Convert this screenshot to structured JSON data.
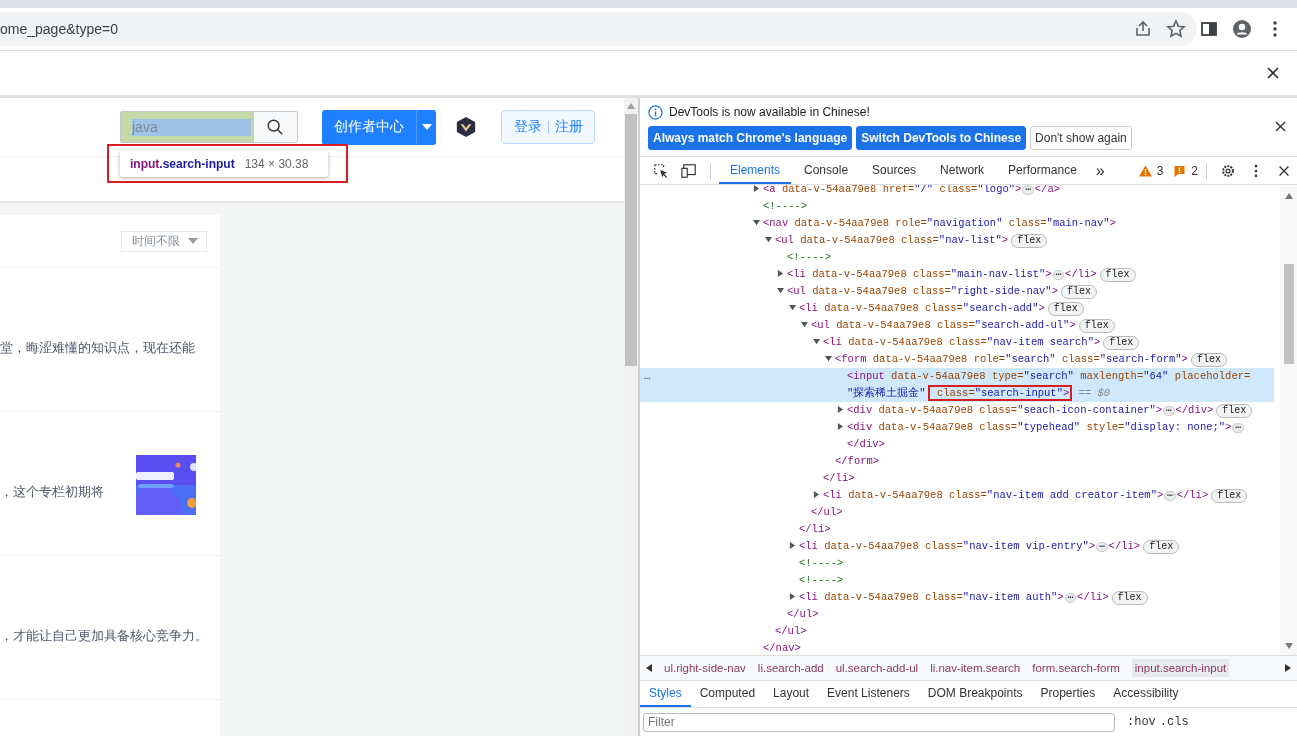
{
  "browser": {
    "url": "ome_page&type=0"
  },
  "page": {
    "search": {
      "value": "java",
      "selected": true
    },
    "creator_button": "创作者中心",
    "login": "登录",
    "register": "注册",
    "inspect_tooltip": {
      "tag": "input",
      "class": ".search-input",
      "size": "134 × 30.38",
      "boxed": true
    },
    "filter": "时间不限",
    "articles": [
      {
        "snippet": "堂，晦涩难懂的知识点，现在还能",
        "thumbnail": false
      },
      {
        "snippet": "，这个专栏初期将",
        "thumbnail": true
      },
      {
        "snippet": "，才能让自己更加具备核心竞争力。",
        "thumbnail": false
      }
    ]
  },
  "devtools": {
    "infobar": {
      "message": "DevTools is now available in Chinese!",
      "buttons": [
        {
          "label": "Always match Chrome's language",
          "kind": "primary"
        },
        {
          "label": "Switch DevTools to Chinese",
          "kind": "primary"
        },
        {
          "label": "Don't show again",
          "kind": "secondary"
        }
      ]
    },
    "tabs": [
      {
        "label": "Elements",
        "selected": true
      },
      {
        "label": "Console",
        "selected": false
      },
      {
        "label": "Sources",
        "selected": false
      },
      {
        "label": "Network",
        "selected": false
      },
      {
        "label": "Performance",
        "selected": false
      }
    ],
    "overflow": "»",
    "warnings": "3",
    "issues": "2",
    "tree": [
      {
        "selected": false,
        "expanded": false,
        "parts": [
          {
            "kind": "tag",
            "text": "<a"
          },
          {
            "kind": "attr",
            "text": " data-v-54aa79e8"
          },
          {
            "kind": "attr",
            "text": " href="
          },
          {
            "kind": "value",
            "text": "\"/\""
          },
          {
            "kind": "attr",
            "text": " class="
          },
          {
            "kind": "value",
            "text": "\"logo\""
          },
          {
            "kind": "tag",
            "text": ">"
          },
          {
            "kind": "more",
            "text": "⋯"
          },
          {
            "kind": "tag",
            "text": "</a>"
          }
        ]
      },
      {
        "selected": false,
        "parts": [
          {
            "kind": "comment",
            "text": "<!---->"
          }
        ]
      },
      {
        "selected": false,
        "expanded": true,
        "parts": [
          {
            "kind": "tag",
            "text": "<nav"
          },
          {
            "kind": "attr",
            "text": " data-v-54aa79e8"
          },
          {
            "kind": "attr",
            "text": " role="
          },
          {
            "kind": "value",
            "text": "\"navigation\""
          },
          {
            "kind": "attr",
            "text": " class="
          },
          {
            "kind": "value",
            "text": "\"main-nav\""
          },
          {
            "kind": "tag",
            "text": ">"
          }
        ],
        "close": "</nav>",
        "children": [
          {
            "selected": false,
            "expanded": true,
            "parts": [
              {
                "kind": "tag",
                "text": "<ul"
              },
              {
                "kind": "attr",
                "text": " data-v-54aa79e8"
              },
              {
                "kind": "attr",
                "text": " class="
              },
              {
                "kind": "value",
                "text": "\"nav-list\""
              },
              {
                "kind": "tag",
                "text": ">"
              },
              {
                "kind": "badge",
                "text": "flex"
              }
            ],
            "close": "</ul>",
            "children": [
              {
                "selected": false,
                "parts": [
                  {
                    "kind": "comment",
                    "text": "<!---->"
                  }
                ]
              },
              {
                "selected": false,
                "expanded": false,
                "parts": [
                  {
                    "kind": "tag",
                    "text": "<li"
                  },
                  {
                    "kind": "attr",
                    "text": " data-v-54aa79e8"
                  },
                  {
                    "kind": "attr",
                    "text": " class="
                  },
                  {
                    "kind": "value",
                    "text": "\"main-nav-list\""
                  },
                  {
                    "kind": "tag",
                    "text": ">"
                  },
                  {
                    "kind": "more",
                    "text": "⋯"
                  },
                  {
                    "kind": "tag",
                    "text": "</li>"
                  },
                  {
                    "kind": "badge",
                    "text": "flex"
                  }
                ]
              },
              {
                "selected": false,
                "expanded": true,
                "parts": [
                  {
                    "kind": "tag",
                    "text": "<ul"
                  },
                  {
                    "kind": "attr",
                    "text": " data-v-54aa79e8"
                  },
                  {
                    "kind": "attr",
                    "text": " class="
                  },
                  {
                    "kind": "value",
                    "text": "\"right-side-nav\""
                  },
                  {
                    "kind": "tag",
                    "text": ">"
                  },
                  {
                    "kind": "badge",
                    "text": "flex"
                  }
                ],
                "close": "</ul>",
                "children": [
                  {
                    "selected": false,
                    "expanded": true,
                    "parts": [
                      {
                        "kind": "tag",
                        "text": "<li"
                      },
                      {
                        "kind": "attr",
                        "text": " data-v-54aa79e8"
                      },
                      {
                        "kind": "attr",
                        "text": " class="
                      },
                      {
                        "kind": "value",
                        "text": "\"search-add\""
                      },
                      {
                        "kind": "tag",
                        "text": ">"
                      },
                      {
                        "kind": "badge",
                        "text": "flex"
                      }
                    ],
                    "close": "</li>",
                    "children": [
                      {
                        "selected": false,
                        "expanded": true,
                        "parts": [
                          {
                            "kind": "tag",
                            "text": "<ul"
                          },
                          {
                            "kind": "attr",
                            "text": " data-v-54aa79e8"
                          },
                          {
                            "kind": "attr",
                            "text": " class="
                          },
                          {
                            "kind": "value",
                            "text": "\"search-add-ul\""
                          },
                          {
                            "kind": "tag",
                            "text": ">"
                          },
                          {
                            "kind": "badge",
                            "text": "flex"
                          }
                        ],
                        "close": "</ul>",
                        "children": [
                          {
                            "selected": false,
                            "expanded": true,
                            "parts": [
                              {
                                "kind": "tag",
                                "text": "<li"
                              },
                              {
                                "kind": "attr",
                                "text": " data-v-54aa79e8"
                              },
                              {
                                "kind": "attr",
                                "text": " class="
                              },
                              {
                                "kind": "value",
                                "text": "\"nav-item search\""
                              },
                              {
                                "kind": "tag",
                                "text": ">"
                              },
                              {
                                "kind": "badge",
                                "text": "flex"
                              }
                            ],
                            "close": "</li>",
                            "children": [
                              {
                                "selected": false,
                                "expanded": true,
                                "parts": [
                                  {
                                    "kind": "tag",
                                    "text": "<form"
                                  },
                                  {
                                    "kind": "attr",
                                    "text": " data-v-54aa79e8"
                                  },
                                  {
                                    "kind": "attr",
                                    "text": " role="
                                  },
                                  {
                                    "kind": "value",
                                    "text": "\"search\""
                                  },
                                  {
                                    "kind": "attr",
                                    "text": " class="
                                  },
                                  {
                                    "kind": "value",
                                    "text": "\"search-form\""
                                  },
                                  {
                                    "kind": "tag",
                                    "text": ">"
                                  },
                                  {
                                    "kind": "badge",
                                    "text": "flex"
                                  }
                                ],
                                "close": "</form>",
                                "children": [
                                  {
                                    "selected": true,
                                    "gutter": "…",
                                    "parts": [
                                      {
                                        "kind": "tag",
                                        "text": "<input"
                                      },
                                      {
                                        "kind": "attr",
                                        "text": " data-v-54aa79e8"
                                      },
                                      {
                                        "kind": "attr",
                                        "text": " type="
                                      },
                                      {
                                        "kind": "value",
                                        "text": "\"search\""
                                      },
                                      {
                                        "kind": "attr",
                                        "text": " maxlength="
                                      },
                                      {
                                        "kind": "value",
                                        "text": "\"64\""
                                      },
                                      {
                                        "kind": "attr",
                                        "text": " placeholder="
                                      },
                                      {
                                        "kind": "value",
                                        "text": "\"探索稀土掘金\""
                                      },
                                      {
                                        "kind": "attr",
                                        "text": " class=",
                                        "boxed": true
                                      },
                                      {
                                        "kind": "value",
                                        "text": "\"search-input\"",
                                        "boxed": true
                                      },
                                      {
                                        "kind": "tag",
                                        "text": ">",
                                        "boxed": true
                                      },
                                      {
                                        "kind": "marker",
                                        "text": " == $0"
                                      }
                                    ]
                                  },
                                  {
                                    "selected": false,
                                    "expanded": false,
                                    "parts": [
                                      {
                                        "kind": "tag",
                                        "text": "<div"
                                      },
                                      {
                                        "kind": "attr",
                                        "text": " data-v-54aa79e8"
                                      },
                                      {
                                        "kind": "attr",
                                        "text": " class="
                                      },
                                      {
                                        "kind": "value",
                                        "text": "\"seach-icon-container\""
                                      },
                                      {
                                        "kind": "tag",
                                        "text": ">"
                                      },
                                      {
                                        "kind": "more",
                                        "text": "⋯"
                                      },
                                      {
                                        "kind": "tag",
                                        "text": "</div>"
                                      },
                                      {
                                        "kind": "badge",
                                        "text": "flex"
                                      }
                                    ]
                                  },
                                  {
                                    "selected": false,
                                    "expanded": false,
                                    "parts": [
                                      {
                                        "kind": "tag",
                                        "text": "<div"
                                      },
                                      {
                                        "kind": "attr",
                                        "text": " data-v-54aa79e8"
                                      },
                                      {
                                        "kind": "attr",
                                        "text": " class="
                                      },
                                      {
                                        "kind": "value",
                                        "text": "\"typehead\""
                                      },
                                      {
                                        "kind": "attr",
                                        "text": " style="
                                      },
                                      {
                                        "kind": "value",
                                        "text": "\"display: none;\""
                                      },
                                      {
                                        "kind": "tag",
                                        "text": ">"
                                      },
                                      {
                                        "kind": "more",
                                        "text": "⋯"
                                      },
                                      {
                                        "kind": "tag",
                                        "text": "</div>"
                                      }
                                    ]
                                  }
                                ]
                              }
                            ]
                          },
                          {
                            "selected": false,
                            "expanded": false,
                            "parts": [
                              {
                                "kind": "tag",
                                "text": "<li"
                              },
                              {
                                "kind": "attr",
                                "text": " data-v-54aa79e8"
                              },
                              {
                                "kind": "attr",
                                "text": " class="
                              },
                              {
                                "kind": "value",
                                "text": "\"nav-item add creator-item\""
                              },
                              {
                                "kind": "tag",
                                "text": ">"
                              },
                              {
                                "kind": "more",
                                "text": "⋯"
                              },
                              {
                                "kind": "tag",
                                "text": "</li>"
                              },
                              {
                                "kind": "badge",
                                "text": "flex"
                              }
                            ]
                          }
                        ]
                      }
                    ]
                  },
                  {
                    "selected": false,
                    "expanded": false,
                    "parts": [
                      {
                        "kind": "tag",
                        "text": "<li"
                      },
                      {
                        "kind": "attr",
                        "text": " data-v-54aa79e8"
                      },
                      {
                        "kind": "attr",
                        "text": " class="
                      },
                      {
                        "kind": "value",
                        "text": "\"nav-item vip-entry\""
                      },
                      {
                        "kind": "tag",
                        "text": ">"
                      },
                      {
                        "kind": "more",
                        "text": "⋯"
                      },
                      {
                        "kind": "tag",
                        "text": "</li>"
                      },
                      {
                        "kind": "badge",
                        "text": "flex"
                      }
                    ]
                  },
                  {
                    "selected": false,
                    "parts": [
                      {
                        "kind": "comment",
                        "text": "<!---->"
                      }
                    ]
                  },
                  {
                    "selected": false,
                    "parts": [
                      {
                        "kind": "comment",
                        "text": "<!---->"
                      }
                    ]
                  },
                  {
                    "selected": false,
                    "expanded": false,
                    "parts": [
                      {
                        "kind": "tag",
                        "text": "<li"
                      },
                      {
                        "kind": "attr",
                        "text": " data-v-54aa79e8"
                      },
                      {
                        "kind": "attr",
                        "text": " class="
                      },
                      {
                        "kind": "value",
                        "text": "\"nav-item auth\""
                      },
                      {
                        "kind": "tag",
                        "text": ">"
                      },
                      {
                        "kind": "more",
                        "text": "⋯"
                      },
                      {
                        "kind": "tag",
                        "text": "</li>"
                      },
                      {
                        "kind": "badge",
                        "text": "flex"
                      }
                    ]
                  }
                ]
              }
            ]
          }
        ]
      }
    ],
    "breadcrumbs": [
      {
        "label": "ul.right-side-nav",
        "selected": false
      },
      {
        "label": "li.search-add",
        "selected": false
      },
      {
        "label": "ul.search-add-ul",
        "selected": false
      },
      {
        "label": "li.nav-item.search",
        "selected": false
      },
      {
        "label": "form.search-form",
        "selected": false
      },
      {
        "label": "input.search-input",
        "selected": true
      }
    ],
    "panel_tabs": [
      {
        "label": "Styles",
        "selected": true
      },
      {
        "label": "Computed",
        "selected": false
      },
      {
        "label": "Layout",
        "selected": false
      },
      {
        "label": "Event Listeners",
        "selected": false
      },
      {
        "label": "DOM Breakpoints",
        "selected": false
      },
      {
        "label": "Properties",
        "selected": false
      },
      {
        "label": "Accessibility",
        "selected": false
      }
    ],
    "filter": {
      "placeholder": "Filter"
    },
    "hov": ":hov",
    "cls": ".cls"
  }
}
